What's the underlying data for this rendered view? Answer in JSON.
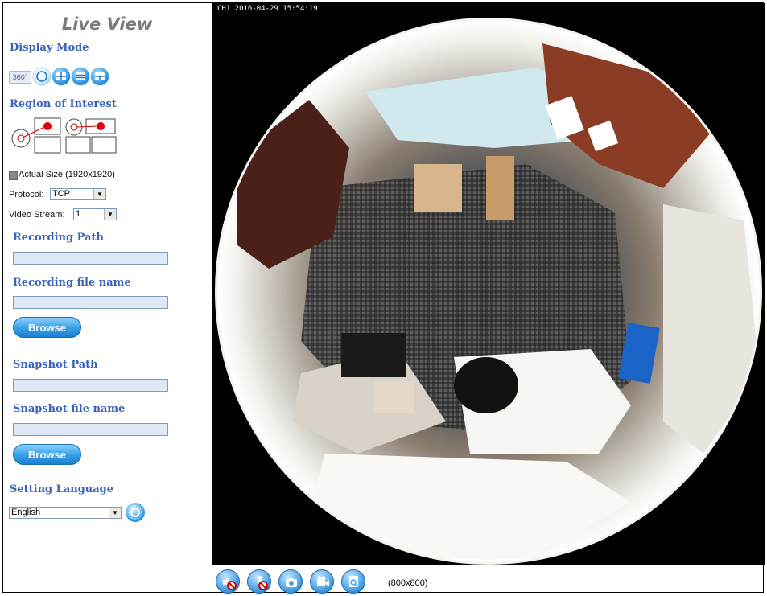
{
  "sidebar": {
    "title": "Live View",
    "display_mode_label": "Display Mode",
    "display_mode_360_label": "360°",
    "display_modes": [
      "circle-icon",
      "quad-view-icon",
      "panorama-icon",
      "split-view-icon"
    ],
    "region_of_interest_label": "Region of Interest",
    "actual_size_label": "Actual Size (1920x1920)",
    "protocol_label": "Protocol:",
    "protocol_value": "TCP",
    "video_stream_label": "Video Stream:",
    "video_stream_value": "1",
    "recording_path_label": "Recording Path",
    "recording_path_value": "",
    "recording_file_name_label": "Recording file name",
    "recording_file_name_value": "",
    "browse_label": "Browse",
    "snapshot_path_label": "Snapshot Path",
    "snapshot_path_value": "",
    "snapshot_file_name_label": "Snapshot file name",
    "snapshot_file_name_value": "",
    "browse2_label": "Browse",
    "setting_language_label": "Setting Language",
    "language_value": "English"
  },
  "video": {
    "osd_text": "CH1 2016-04-29 15:54:19",
    "resolution": "(800x800)"
  },
  "toolbar": {
    "buttons": [
      "speaker-mute-icon",
      "microphone-mute-icon",
      "snapshot-icon",
      "record-icon",
      "zoom-icon"
    ]
  },
  "colors": {
    "section_label": "#3a62b8",
    "button_blue": "#1c8ad8"
  }
}
